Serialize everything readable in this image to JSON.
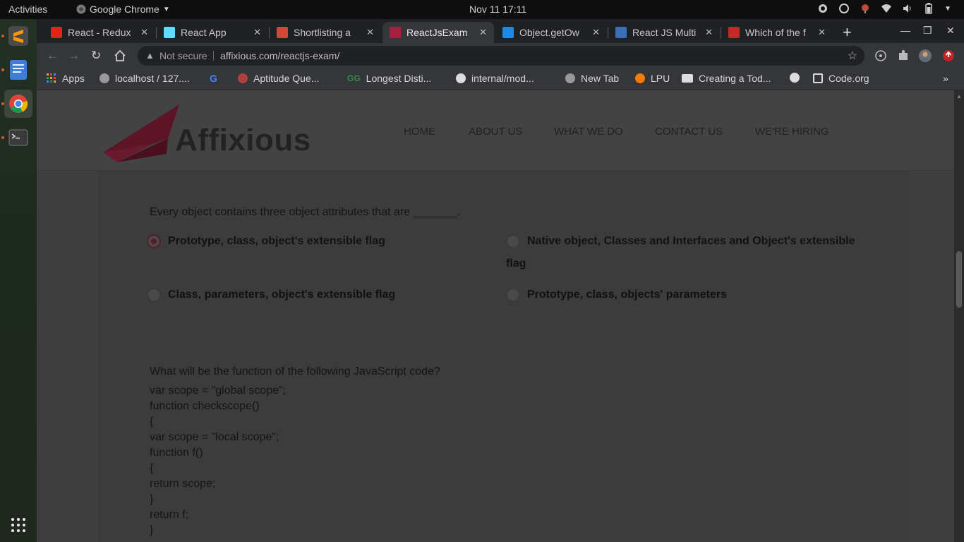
{
  "topbar": {
    "activities": "Activities",
    "app_name": "Google Chrome",
    "clock": "Nov 11  17:11"
  },
  "dock": {
    "items": [
      "sublime-text",
      "text-editor",
      "google-chrome",
      "terminal",
      "show-applications"
    ]
  },
  "tabs": [
    {
      "title": "React - Redux",
      "favicon_color": "#e62117"
    },
    {
      "title": "React App",
      "favicon_color": "#61dafb"
    },
    {
      "title": "Shortlisting a",
      "favicon_color": "#d44638"
    },
    {
      "title": "ReactJsExam",
      "favicon_color": "#a3213f"
    },
    {
      "title": "Object.getOw",
      "favicon_color": "#1e88e5"
    },
    {
      "title": "React JS Multi",
      "favicon_color": "#3b6fb6"
    },
    {
      "title": "Which of the f",
      "favicon_color": "#c62828"
    }
  ],
  "omnibox": {
    "security": "Not secure",
    "url": "affixious.com/reactjs-exam/"
  },
  "bookmarks": [
    {
      "label": "Apps",
      "icon_color": "#e8a33d"
    },
    {
      "label": "localhost / 127....",
      "icon_color": "#999999"
    },
    {
      "label": "",
      "icon_color": "#4285f4"
    },
    {
      "label": "Aptitude Que...",
      "icon_color": "#b0413e"
    },
    {
      "label": "Longest Disti...",
      "icon_color": "#2f8d46"
    },
    {
      "label": "internal/mod...",
      "icon_color": "#dddddd"
    },
    {
      "label": "New Tab",
      "icon_color": "#999999"
    },
    {
      "label": "LPU",
      "icon_color": "#f57c00"
    },
    {
      "label": "Creating a Tod...",
      "icon_color": "#dddddd"
    },
    {
      "label": "",
      "icon_color": "#dddddd"
    },
    {
      "label": "Code.org",
      "icon_color": "#dddddd"
    }
  ],
  "site": {
    "logo_text": "Affixious",
    "brand_color": "#a3213f",
    "nav": [
      "HOME",
      "ABOUT US",
      "WHAT WE DO",
      "CONTACT US",
      "WE'RE HIRING"
    ]
  },
  "question1": {
    "text": "Every object contains three object attributes that are _______.",
    "options": [
      {
        "label": "Prototype, class, object's extensible flag",
        "selected": true
      },
      {
        "label": "Native object, Classes and Interfaces and Object's extensible",
        "cont": "flag",
        "selected": false
      },
      {
        "label": "Class, parameters, object's extensible flag",
        "selected": false
      },
      {
        "label": "Prototype, class, objects' parameters",
        "selected": false
      }
    ]
  },
  "question2": {
    "text": "What will be the function of the following JavaScript code?",
    "code": [
      "var scope = \"global scope\";",
      "function checkscope()",
      "{",
      "var scope = \"local scope\";",
      "function f()",
      "{",
      "return scope;",
      "}",
      "return f;",
      "}"
    ]
  }
}
